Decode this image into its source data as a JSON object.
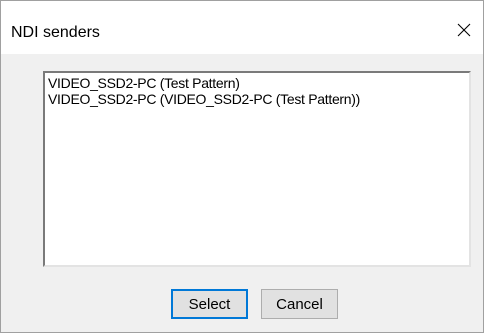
{
  "window": {
    "title": "NDI senders"
  },
  "icons": {
    "close": "close-icon"
  },
  "senders": {
    "items": [
      "VIDEO_SSD2-PC (Test Pattern)",
      "VIDEO_SSD2-PC (VIDEO_SSD2-PC (Test Pattern))"
    ]
  },
  "buttons": {
    "select_label": "Select",
    "cancel_label": "Cancel"
  },
  "colors": {
    "dialog_background": "#f0f0f0",
    "titlebar_background": "#ffffff",
    "default_button_border": "#0078d7"
  }
}
